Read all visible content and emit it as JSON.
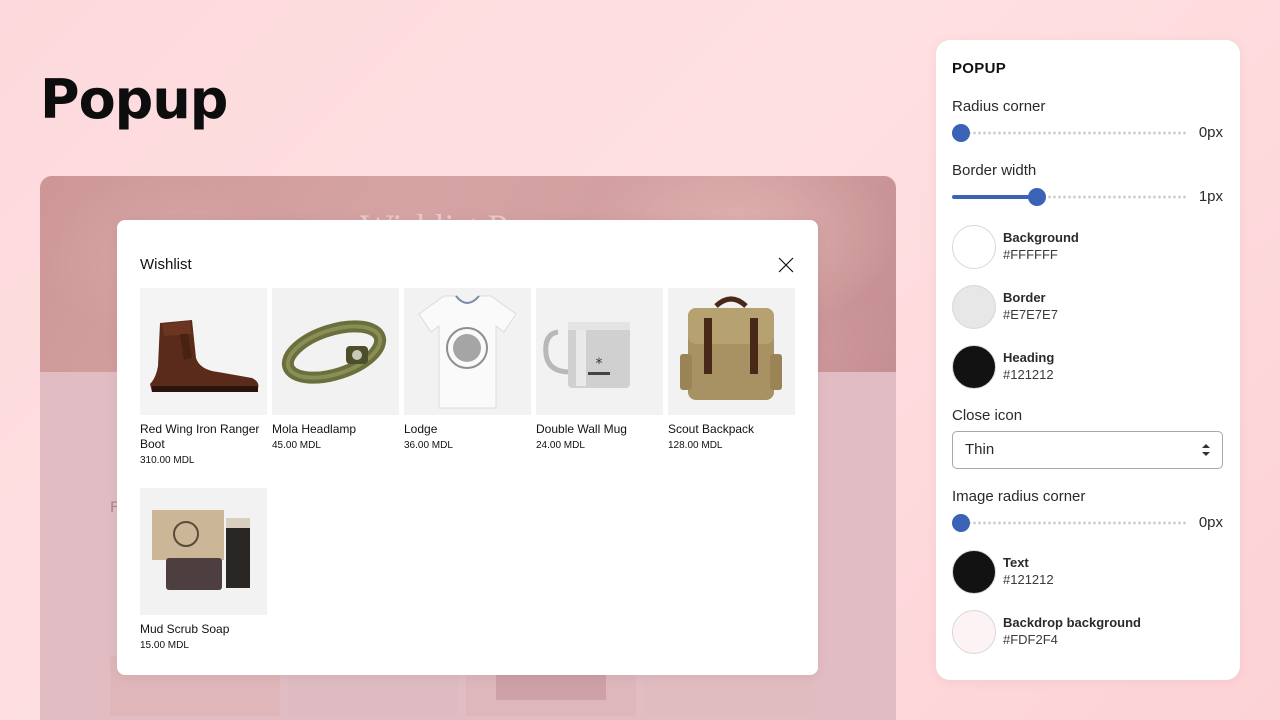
{
  "page": {
    "title": "Popup"
  },
  "preview": {
    "hero_text": "Wishlist P",
    "background_label": "F"
  },
  "modal": {
    "title": "Wishlist",
    "close_icon": "close-icon",
    "products": [
      {
        "name": "Red Wing Iron Ranger Boot",
        "price": "310.00 MDL",
        "image": "boot"
      },
      {
        "name": "Mola Headlamp",
        "price": "45.00 MDL",
        "image": "headlamp"
      },
      {
        "name": "Lodge",
        "price": "36.00 MDL",
        "image": "tshirt"
      },
      {
        "name": "Double Wall Mug",
        "price": "24.00 MDL",
        "image": "mug"
      },
      {
        "name": "Scout Backpack",
        "price": "128.00 MDL",
        "image": "backpack"
      },
      {
        "name": "Mud Scrub Soap",
        "price": "15.00 MDL",
        "image": "soap"
      }
    ]
  },
  "panel": {
    "heading": "POPUP",
    "radius_corner": {
      "label": "Radius corner",
      "value": "0px",
      "level": 0
    },
    "border_width": {
      "label": "Border width",
      "value": "1px",
      "level": 0.35
    },
    "colors": [
      {
        "name": "Background",
        "hex": "#FFFFFF",
        "swatch": "#FFFFFF"
      },
      {
        "name": "Border",
        "hex": "#E7E7E7",
        "swatch": "#E7E7E7"
      },
      {
        "name": "Heading",
        "hex": "#121212",
        "swatch": "#121212"
      }
    ],
    "close_icon": {
      "label": "Close icon",
      "selected": "Thin"
    },
    "image_radius_corner": {
      "label": "Image radius corner",
      "value": "0px",
      "level": 0
    },
    "colors2": [
      {
        "name": "Text",
        "hex": "#121212",
        "swatch": "#121212"
      },
      {
        "name": "Backdrop background",
        "hex": "#FDF2F4",
        "swatch": "#FDF2F4"
      }
    ],
    "accent": "#3A63B8"
  }
}
